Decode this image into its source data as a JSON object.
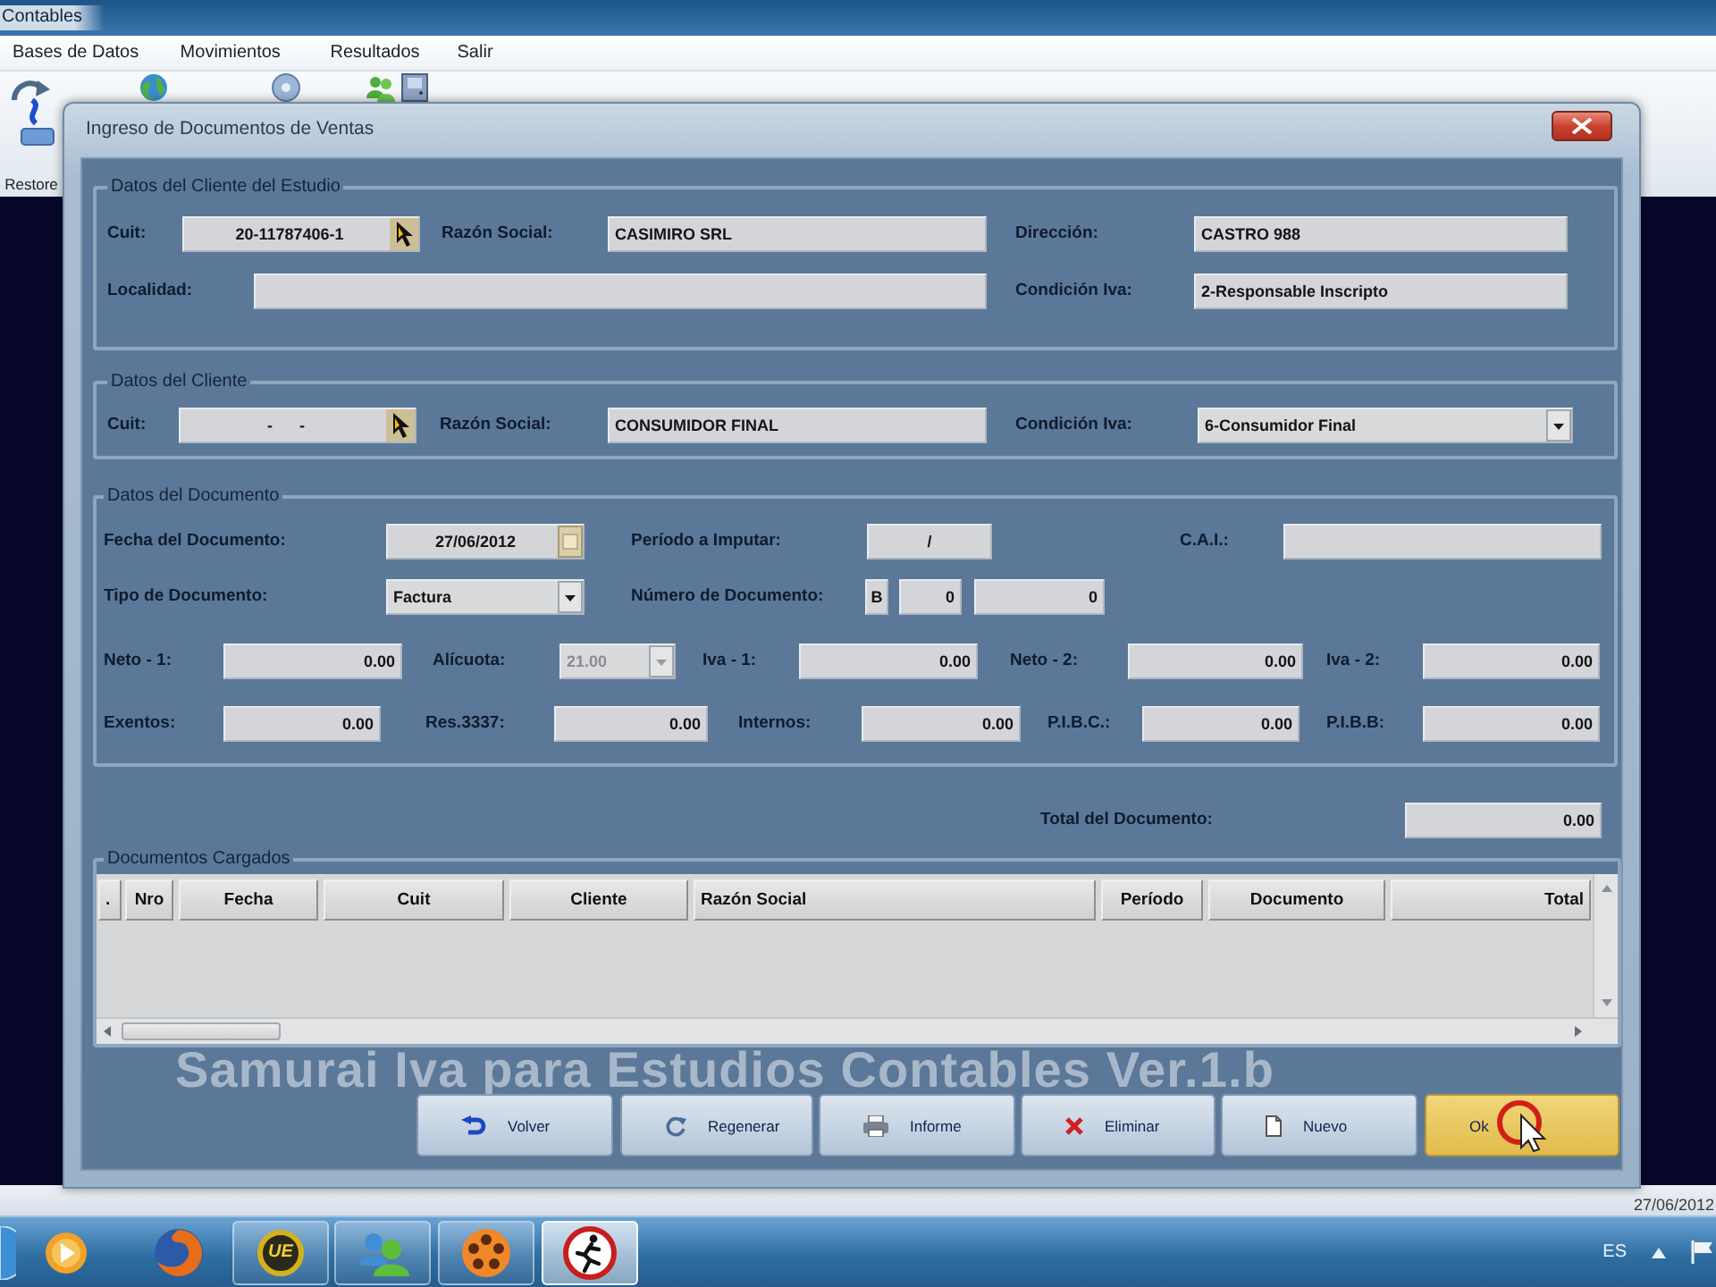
{
  "app_window": {
    "title": "Contables",
    "menu": [
      "Bases de Datos",
      "Movimientos",
      "Resultados",
      "Salir"
    ],
    "toolbar": {
      "label": "Restore"
    },
    "status_bar": {
      "date": "27/06/2012"
    }
  },
  "dialog": {
    "title": "Ingreso de Documentos de Ventas",
    "groups": [
      {
        "legend": "Datos del Cliente del Estudio",
        "fields": [
          {
            "label": "Cuit:",
            "kind": "lookup",
            "value": "20-11787406-1"
          },
          {
            "label": "Razón Social:",
            "kind": "text",
            "value": "CASIMIRO SRL"
          },
          {
            "label": "Dirección:",
            "kind": "text",
            "value": "CASTRO 988"
          },
          {
            "label": "Localidad:",
            "kind": "text"
          },
          {
            "label": "Condición Iva:",
            "kind": "text",
            "value": "2-Responsable Inscripto"
          }
        ]
      },
      {
        "legend": "Datos del Cliente",
        "fields": [
          {
            "label": "Cuit:",
            "kind": "lookup",
            "value": "-      -"
          },
          {
            "label": "Razón Social:",
            "kind": "text",
            "value": "CONSUMIDOR FINAL"
          },
          {
            "label": "Condición Iva:",
            "kind": "select",
            "value": "6-Consumidor Final",
            "disabled": false
          }
        ]
      },
      {
        "legend": "Datos del Documento",
        "fields": [
          {
            "label": "Fecha del Documento:",
            "kind": "date",
            "value": "27/06/2012"
          },
          {
            "label": "Período a Imputar:",
            "kind": "text",
            "value": "/"
          },
          {
            "label": "C.A.I.:",
            "kind": "text"
          },
          {
            "label": "Tipo de Documento:",
            "kind": "select",
            "value": "Factura",
            "disabled": false
          },
          {
            "label": "Número de Documento:",
            "kind": "multi",
            "parts": [
              "B",
              "0",
              "0"
            ]
          },
          {
            "label": "Neto - 1:",
            "kind": "text",
            "value": "0.00"
          },
          {
            "label": "Alícuota:",
            "kind": "select",
            "value": "21.00",
            "disabled": true
          },
          {
            "label": "Iva - 1:",
            "kind": "text",
            "value": "0.00"
          },
          {
            "label": "Neto - 2:",
            "kind": "text",
            "value": "0.00"
          },
          {
            "label": "Iva - 2:",
            "kind": "text",
            "value": "0.00"
          },
          {
            "label": "Exentos:",
            "kind": "text",
            "value": "0.00"
          },
          {
            "label": "Res.3337:",
            "kind": "text",
            "value": "0.00"
          },
          {
            "label": "Internos:",
            "kind": "text",
            "value": "0.00"
          },
          {
            "label": "P.I.B.C.:",
            "kind": "text",
            "value": "0.00"
          },
          {
            "label": "P.I.B.B:",
            "kind": "text",
            "value": "0.00"
          }
        ]
      }
    ],
    "total": {
      "label": "Total del Documento:",
      "value": "0.00"
    },
    "documents": {
      "legend": "Documentos Cargados",
      "columns": [
        ".",
        "Nro",
        "Fecha",
        "Cuit",
        "Cliente",
        "Razón Social",
        "Período",
        "Documento",
        "Total"
      ]
    },
    "banner": "Samurai Iva para Estudios Contables Ver.1.b",
    "buttons": [
      {
        "label": "Volver",
        "highlighted": false
      },
      {
        "label": "Regenerar",
        "highlighted": false
      },
      {
        "label": "Informe",
        "highlighted": false
      },
      {
        "label": "Eliminar",
        "highlighted": false
      },
      {
        "label": "Nuevo",
        "highlighted": false
      },
      {
        "label": "Ok",
        "highlighted": true
      }
    ]
  },
  "taskbar": {
    "items": [
      {
        "running": false,
        "active": false
      },
      {
        "running": false,
        "active": false
      },
      {
        "running": true,
        "active": false,
        "badge": "UE"
      },
      {
        "running": true,
        "active": false
      },
      {
        "running": true,
        "active": false
      },
      {
        "running": true,
        "active": true
      }
    ],
    "language": "ES"
  }
}
